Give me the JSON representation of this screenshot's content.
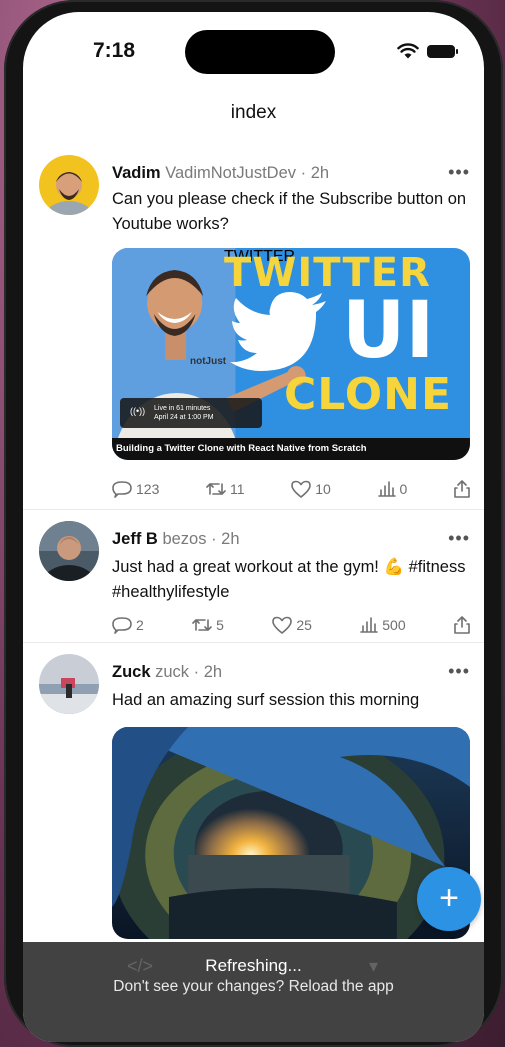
{
  "status": {
    "time": "7:18"
  },
  "nav": {
    "title": "index"
  },
  "posts": [
    {
      "name": "Vadim",
      "handle": "VadimNotJustDev",
      "time": "2h",
      "text": "Can you please check if the Subscribe button on Youtube works?",
      "media": {
        "headline_1": "TWITTER",
        "headline_2": "UI",
        "headline_3": "CLONE",
        "live_line_1": "Live in 61 minutes",
        "live_line_2": "April 24 at 1:00 PM",
        "caption": "Building a Twitter Clone with React Native from Scratch",
        "shirt_text": "notJust"
      },
      "stats": {
        "replies": "123",
        "retweets": "11",
        "likes": "10",
        "impressions": "0"
      }
    },
    {
      "name": "Jeff B",
      "handle": "bezos",
      "time": "2h",
      "text": "Just had a great workout at the gym! 💪 #fitness #healthylifestyle",
      "stats": {
        "replies": "2",
        "retweets": "5",
        "likes": "25",
        "impressions": "500"
      }
    },
    {
      "name": "Zuck",
      "handle": "zuck",
      "time": "2h",
      "text": "Had an amazing surf session this morning"
    }
  ],
  "fab": {
    "label": "+"
  },
  "toast": {
    "line_1": "Refreshing...",
    "line_2": "Don't see your changes? Reload the app"
  },
  "colors": {
    "accent": "#2c92e4",
    "thumbnail_blue": "#2f8fe0",
    "thumbnail_yellow": "#f6d43b",
    "muted": "#7a7a7a"
  },
  "icons": [
    "wifi-icon",
    "battery-icon",
    "more-icon",
    "reply-icon",
    "retweet-icon",
    "like-icon",
    "impressions-icon",
    "share-icon",
    "plus-icon"
  ]
}
